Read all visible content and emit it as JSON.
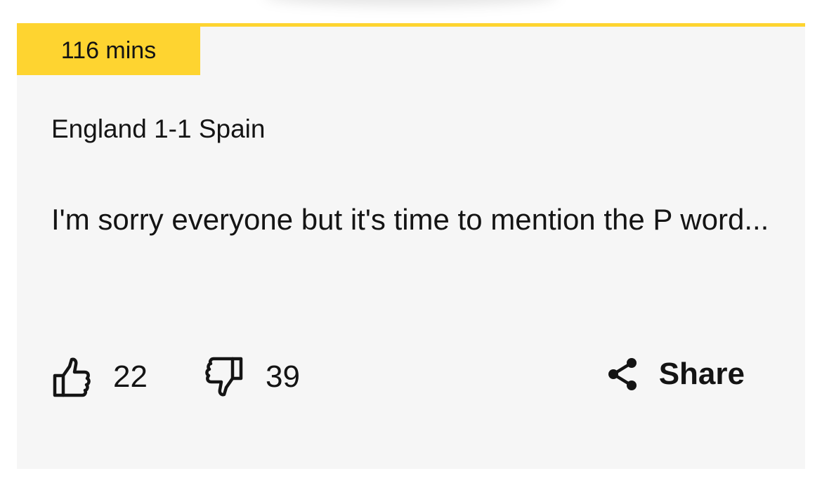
{
  "post": {
    "time": "116 mins",
    "title": "England 1-1 Spain",
    "body": "I'm sorry everyone but it's time to mention the P word..."
  },
  "reactions": {
    "likes": "22",
    "dislikes": "39"
  },
  "actions": {
    "share_label": "Share"
  },
  "icons": {
    "like": "thumbs-up-icon",
    "dislike": "thumbs-down-icon",
    "share": "share-icon"
  },
  "colors": {
    "accent": "#fed430",
    "card_background": "#f6f6f6",
    "text": "#141414"
  }
}
